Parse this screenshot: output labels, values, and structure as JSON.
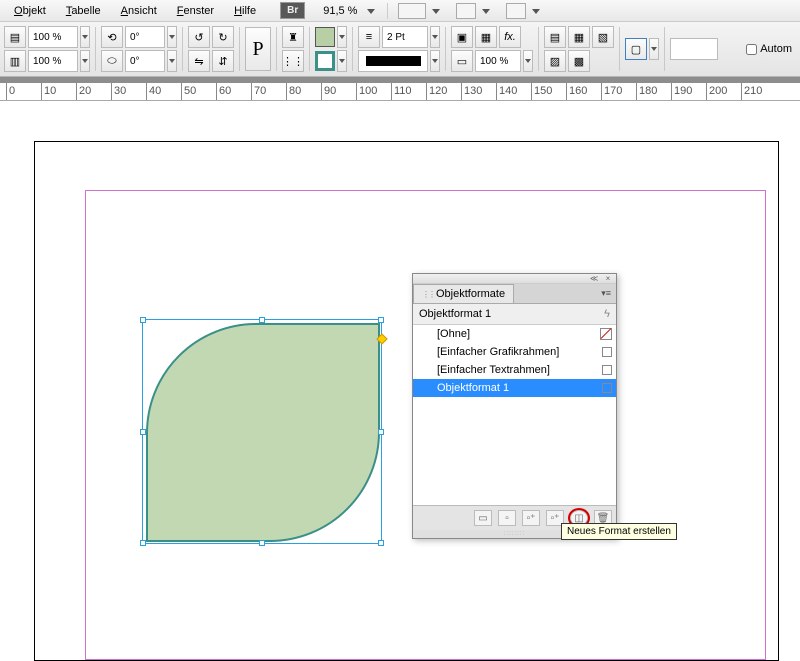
{
  "menu": {
    "items": [
      "Objekt",
      "Tabelle",
      "Ansicht",
      "Fenster",
      "Hilfe"
    ],
    "bridge": "Br",
    "zoom": "91,5 %"
  },
  "toolbar": {
    "opacity1": "100 %",
    "opacity2": "100 %",
    "angle1": "0°",
    "angle2": "0°",
    "stroke_weight": "2 Pt",
    "scale": "100 %",
    "autom": "Autom"
  },
  "ruler": {
    "ticks": [
      0,
      10,
      20,
      30,
      40,
      50,
      60,
      70,
      80,
      90,
      100,
      110,
      120,
      130,
      140,
      150,
      160,
      170,
      180,
      190,
      200,
      210
    ]
  },
  "panel": {
    "title": "Objektformate",
    "current": "Objektformat 1",
    "items": [
      {
        "label": "[Ohne]",
        "none": true
      },
      {
        "label": "[Einfacher Grafikrahmen]"
      },
      {
        "label": "[Einfacher Textrahmen]"
      },
      {
        "label": "Objektformat 1",
        "selected": true
      }
    ]
  },
  "tooltip": "Neues Format erstellen"
}
